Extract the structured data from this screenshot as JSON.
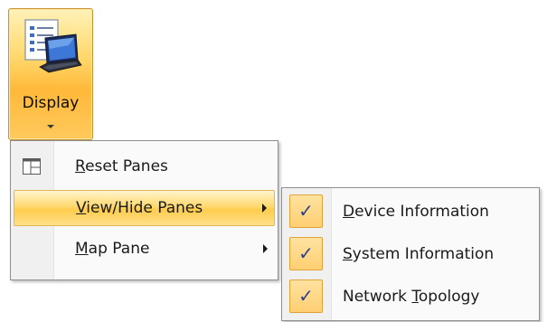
{
  "ribbon": {
    "display_button": {
      "label": "Display",
      "icon": "display-panes-icon"
    }
  },
  "menu": {
    "items": [
      {
        "pre": "",
        "acc": "R",
        "post": "eset Panes",
        "icon": "reset-panes-icon",
        "has_submenu": false,
        "highlighted": false
      },
      {
        "pre": "",
        "acc": "V",
        "post": "iew/Hide Panes",
        "icon": "",
        "has_submenu": true,
        "highlighted": true
      },
      {
        "pre": "",
        "acc": "M",
        "post": "ap Pane",
        "icon": "",
        "has_submenu": true,
        "highlighted": false
      }
    ]
  },
  "submenu": {
    "check_glyph": "✓",
    "items": [
      {
        "pre": "",
        "acc": "D",
        "post": "evice Information",
        "checked": true
      },
      {
        "pre": "",
        "acc": "S",
        "post": "ystem Information",
        "checked": true
      },
      {
        "pre": "Network ",
        "acc": "T",
        "post": "opology",
        "checked": true
      }
    ]
  },
  "colors": {
    "highlight": "#ffd970",
    "check_bg": "#ffcf72",
    "check_mark": "#2f3f8a"
  }
}
